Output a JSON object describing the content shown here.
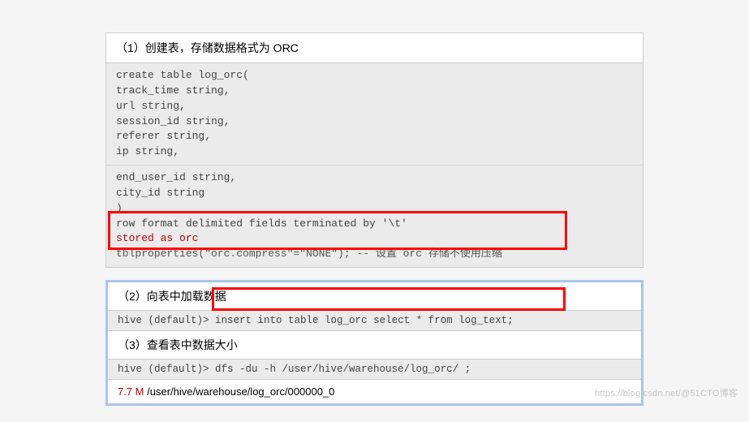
{
  "block1": {
    "header": "（1）创建表，存储数据格式为 ORC",
    "code_part1": "create table log_orc(\ntrack_time string,\nurl string,\nsession_id string,\nreferer string,\nip string,",
    "code_part2": "end_user_id string,\ncity_id string\n)\nrow format delimited fields terminated by '\\t'",
    "stored_line": "stored as orc",
    "tblprops": "tblproperties(\"orc.compress\"=\"NONE\"); -- 设置 orc 存储不使用压缩"
  },
  "block2": {
    "header2": "（2）向表中加载数据",
    "line2_prompt": "hive (default)> ",
    "line2_cmd": "insert into table log_orc select * from log_text;",
    "header3": "（3）查看表中数据大小",
    "line3": "hive (default)> dfs -du -h /user/hive/warehouse/log_orc/ ;",
    "result_size": "7.7 M",
    "result_path": "   /user/hive/warehouse/log_orc/000000_0"
  },
  "watermark": "https://blog.csdn.net/@51CTO博客"
}
